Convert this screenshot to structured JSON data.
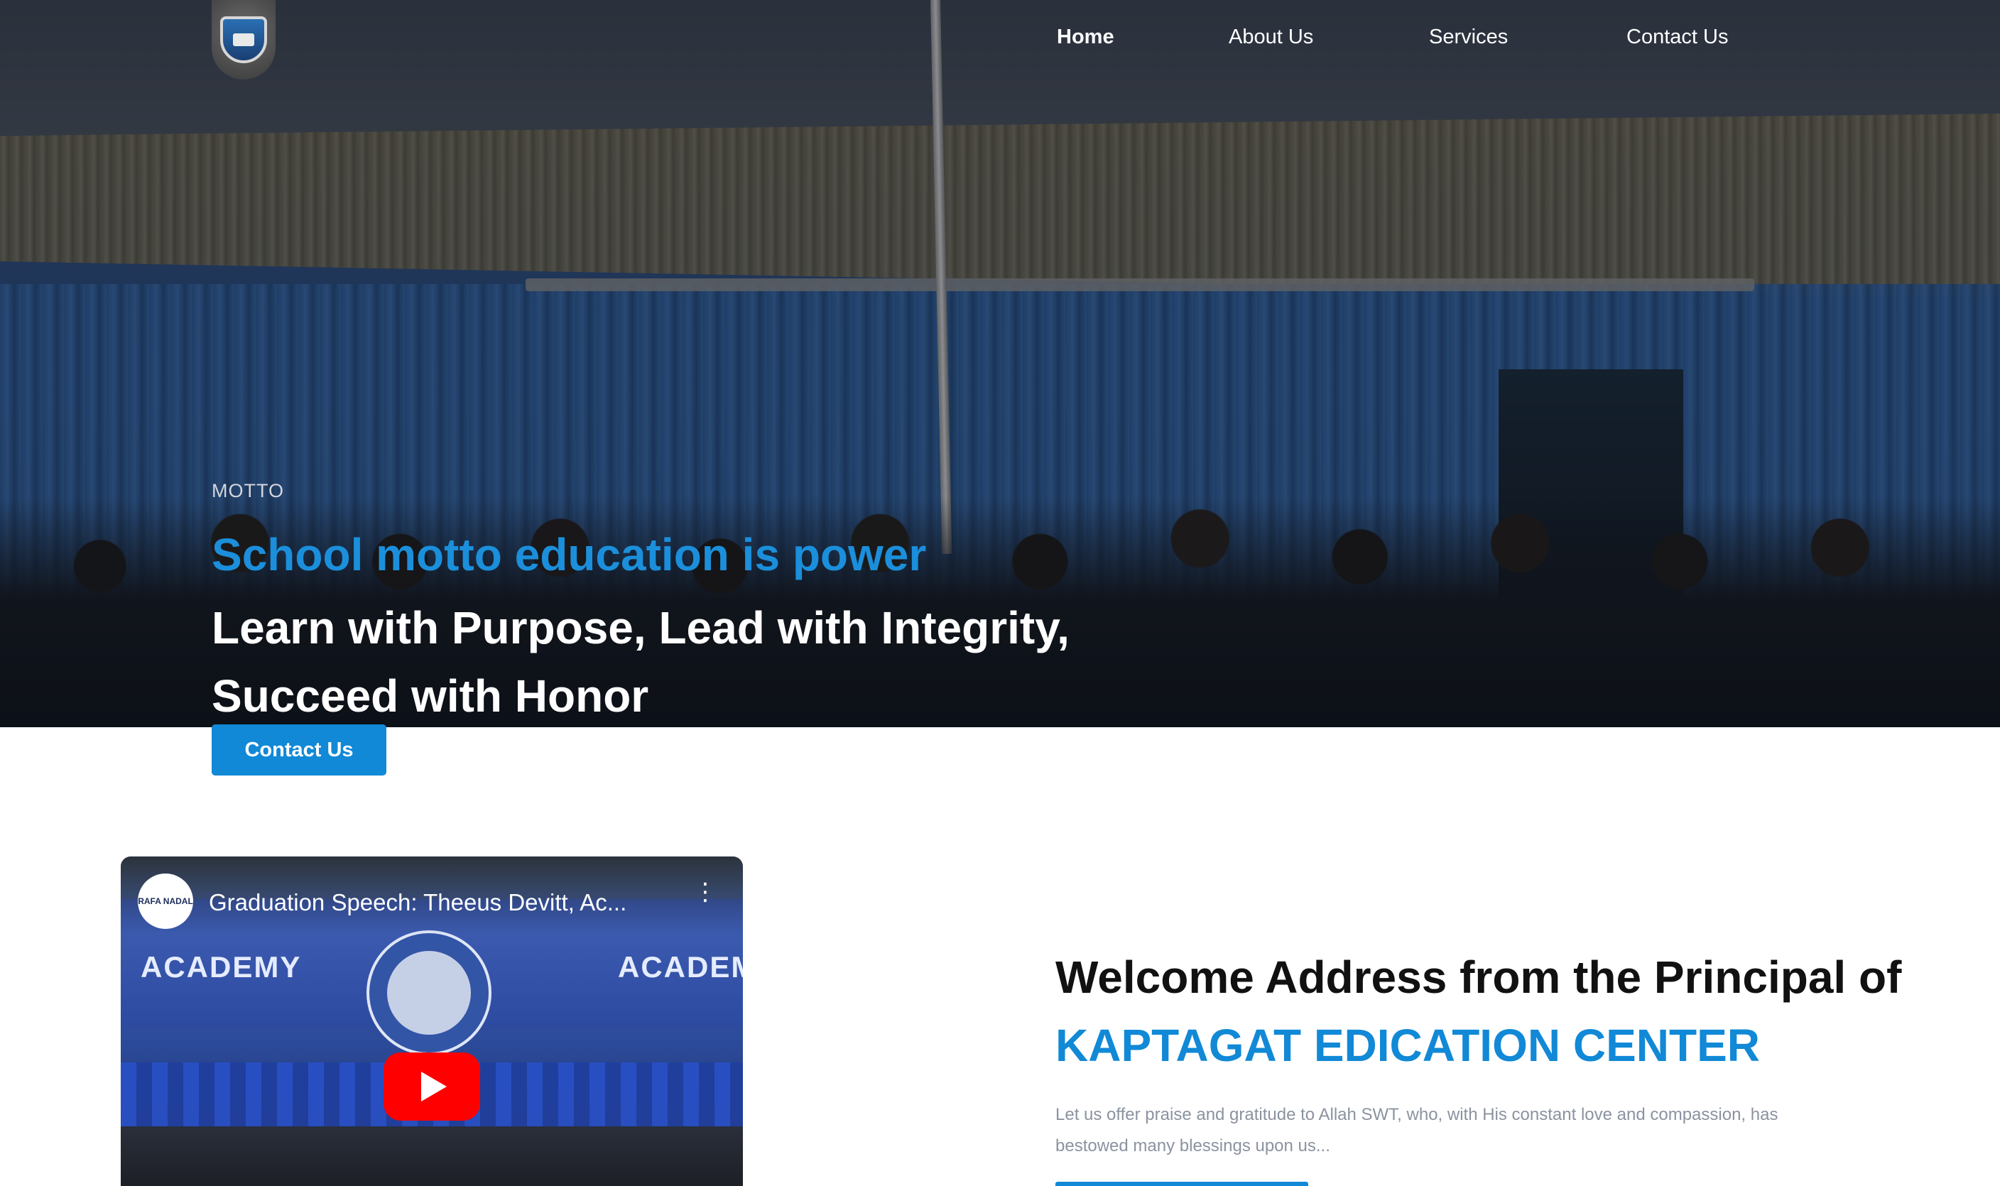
{
  "nav": {
    "items": [
      {
        "label": "Home",
        "active": true
      },
      {
        "label": "About Us",
        "active": false
      },
      {
        "label": "Services",
        "active": false
      },
      {
        "label": "Contact Us",
        "active": false
      }
    ]
  },
  "hero": {
    "motto_label": "MOTTO",
    "motto_line": "School motto education is power",
    "tagline": "Learn with Purpose, Lead with Integrity, Succeed with Honor",
    "cta_label": "Contact Us"
  },
  "video": {
    "title": "Graduation Speech: Theeus Devitt, Ac...",
    "banner_left": "ACADEMY",
    "banner_right": "ACADEM",
    "channel_initials": "RAFA NADAL"
  },
  "welcome": {
    "title_prefix": "Welcome Address from the Principal of ",
    "title_highlight": "KAPTAGAT EDICATION CENTER",
    "body": "Let us offer praise and gratitude to Allah SWT, who, with His constant love and compassion, has bestowed many blessings upon us..."
  },
  "colors": {
    "accent": "#1189d6",
    "motto_blue": "#1b8fdb",
    "body_gray": "#8b93a0"
  }
}
